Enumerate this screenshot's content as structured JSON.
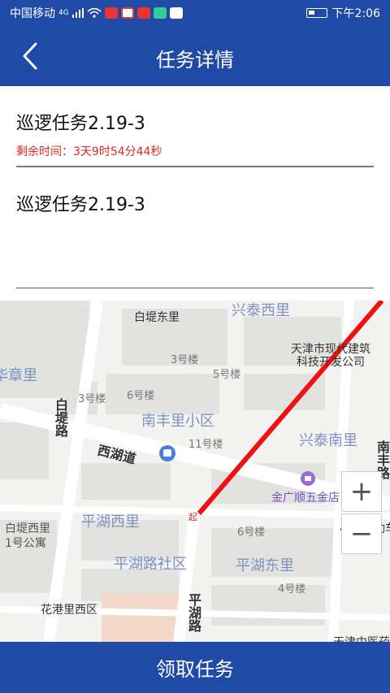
{
  "status_bar": {
    "carrier": "中国移动",
    "network": "4G",
    "time": "下午2:06"
  },
  "header": {
    "title": "任务详情"
  },
  "task": {
    "name": "巡逻任务2.19-3",
    "remaining_label": "剩余时间：",
    "remaining_value": "3天9时54分44秒",
    "description": "巡逻任务2.19-3"
  },
  "map": {
    "labels": {
      "baidi_dongli": "白堤东里",
      "xingtai_xili": "兴泰西里",
      "tianjin_company": "天津市现代建筑\n科技开发公司",
      "zhang_li": "华章里",
      "bldg3a": "3号楼",
      "bldg5": "5号楼",
      "bldg3b": "3号楼",
      "bldg6a": "6号楼",
      "baidi_road": "白堤路",
      "nanfeng_community": "南丰里小区",
      "xingtai_nanli": "兴泰南里",
      "bldg11": "11号楼",
      "xihu_road": "西湖道",
      "hardware_store": "金广顺五金店",
      "nanfeng_road": "南丰路",
      "baidi_xili": "白堤西里\n1号公寓",
      "pinghu_xili": "平湖西里",
      "bldg6b": "6号楼",
      "xiaowang": "小王电动车",
      "pinghu_community": "平湖路社区",
      "pinghu_dongli": "平湖东里",
      "bldg4": "4号楼",
      "huagang_west": "花港里西区",
      "pinghu_road": "平湖路",
      "tianjin_hospital": "天津中医药"
    },
    "start_marker": "起",
    "zoom_in": "+",
    "zoom_out": "−",
    "route_color": "#ee1111"
  },
  "actions": {
    "claim_label": "领取任务"
  },
  "colors": {
    "primary": "#1f4aa6",
    "alert": "#e0262a"
  }
}
